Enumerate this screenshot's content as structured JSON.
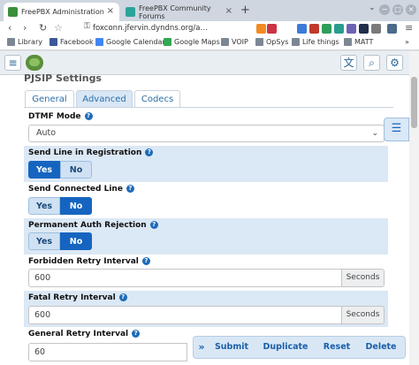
{
  "browser": {
    "tabs": [
      {
        "title": "FreePBX Administration",
        "active": true,
        "favicon_color": "#3b8f3b"
      },
      {
        "title": "FreePBX Community Forums",
        "active": false,
        "favicon_color": "#2aa59a"
      }
    ],
    "new_tab_glyph": "+",
    "tab_list_glyph": "⌄",
    "window_controls": {
      "minimize": "−",
      "maximize": "□",
      "close": "×"
    },
    "url": "foxconn.jfervin.dyndns.org/a…",
    "back_glyph": "‹",
    "forward_glyph": "›",
    "reload_glyph": "↻",
    "lock_glyph": "⚿"
  },
  "bookmarks": [
    {
      "label": "Library",
      "icon": "folder-icon"
    },
    {
      "label": "Facebook",
      "icon": "facebook-icon",
      "color": "#3b5998"
    },
    {
      "label": "Google Calendar",
      "icon": "calendar-icon",
      "color": "#4285f4"
    },
    {
      "label": "Google Maps",
      "icon": "maps-icon",
      "color": "#34a853"
    },
    {
      "label": "VOIP",
      "icon": "folder-icon"
    },
    {
      "label": "OpSys",
      "icon": "folder-icon"
    },
    {
      "label": "Life things",
      "icon": "folder-icon"
    },
    {
      "label": "MATT",
      "icon": "folder-icon"
    }
  ],
  "app_header": {
    "menu_glyph": "≡",
    "lang_glyph": "文",
    "search_glyph": "⌕",
    "settings_glyph": "⚙"
  },
  "form": {
    "section_title": "PJSIP Settings",
    "tabs": [
      {
        "label": "General",
        "active": false
      },
      {
        "label": "Advanced",
        "active": true
      },
      {
        "label": "Codecs",
        "active": false
      }
    ],
    "help_glyph": "?",
    "dtmf_mode": {
      "label": "DTMF Mode",
      "value": "Auto",
      "caret": "⌄"
    },
    "send_line_in_registration": {
      "label": "Send Line in Registration",
      "yes": "Yes",
      "no": "No",
      "selected": "Yes"
    },
    "send_connected_line": {
      "label": "Send Connected Line",
      "yes": "Yes",
      "no": "No",
      "selected": "No"
    },
    "permanent_auth_rejection": {
      "label": "Permanent Auth Rejection",
      "yes": "Yes",
      "no": "No",
      "selected": "No"
    },
    "forbidden_retry_interval": {
      "label": "Forbidden Retry Interval",
      "value": "600",
      "unit": "Seconds"
    },
    "fatal_retry_interval": {
      "label": "Fatal Retry Interval",
      "value": "600",
      "unit": "Seconds"
    },
    "general_retry_interval": {
      "label": "General Retry Interval",
      "value": "60"
    }
  },
  "side_list_glyph": "☰",
  "actions": {
    "expand": "»",
    "submit": "Submit",
    "duplicate": "Duplicate",
    "reset": "Reset",
    "delete": "Delete"
  },
  "colors": {
    "accent": "#1565c0",
    "shaded_row": "#dbe8f5",
    "link": "#2a6fa8"
  }
}
